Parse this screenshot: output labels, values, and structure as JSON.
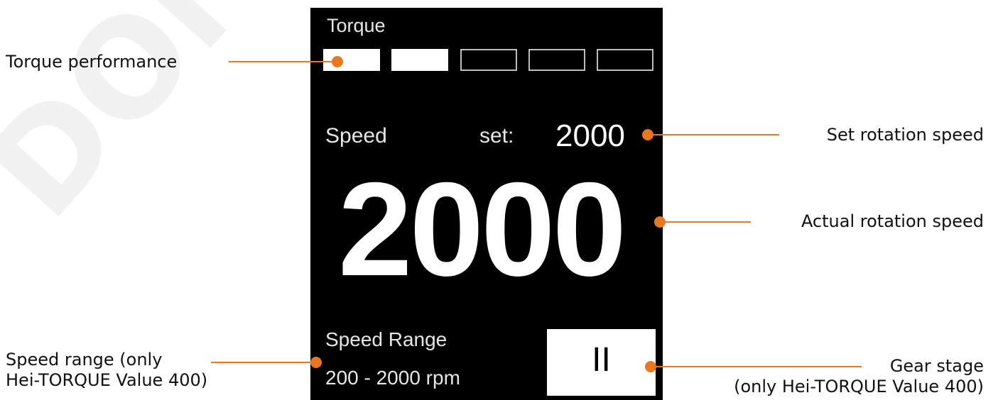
{
  "watermark": "DOMINO",
  "display": {
    "torque": {
      "label": "Torque",
      "segments_total": 5,
      "segments_filled": 2
    },
    "speed": {
      "label": "Speed",
      "set_label": "set:",
      "set_value": "2000",
      "actual_value": "2000"
    },
    "range": {
      "label": "Speed Range",
      "value": "200 - 2000   rpm"
    },
    "gear": {
      "value": "II"
    }
  },
  "annotations": {
    "torque_performance": "Torque performance",
    "set_rotation_speed": "Set rotation speed",
    "actual_rotation_speed": "Actual rotation speed",
    "speed_range_line1": "Speed range (only",
    "speed_range_line2": "Hei-TORQUE Value 400)",
    "gear_stage_line1": "Gear stage",
    "gear_stage_line2": "(only Hei-TORQUE Value 400)"
  },
  "colors": {
    "accent": "#e87722",
    "screen": "#000000",
    "bar_filled": "#ffffff",
    "bar_empty_border": "#bdbdbd"
  }
}
